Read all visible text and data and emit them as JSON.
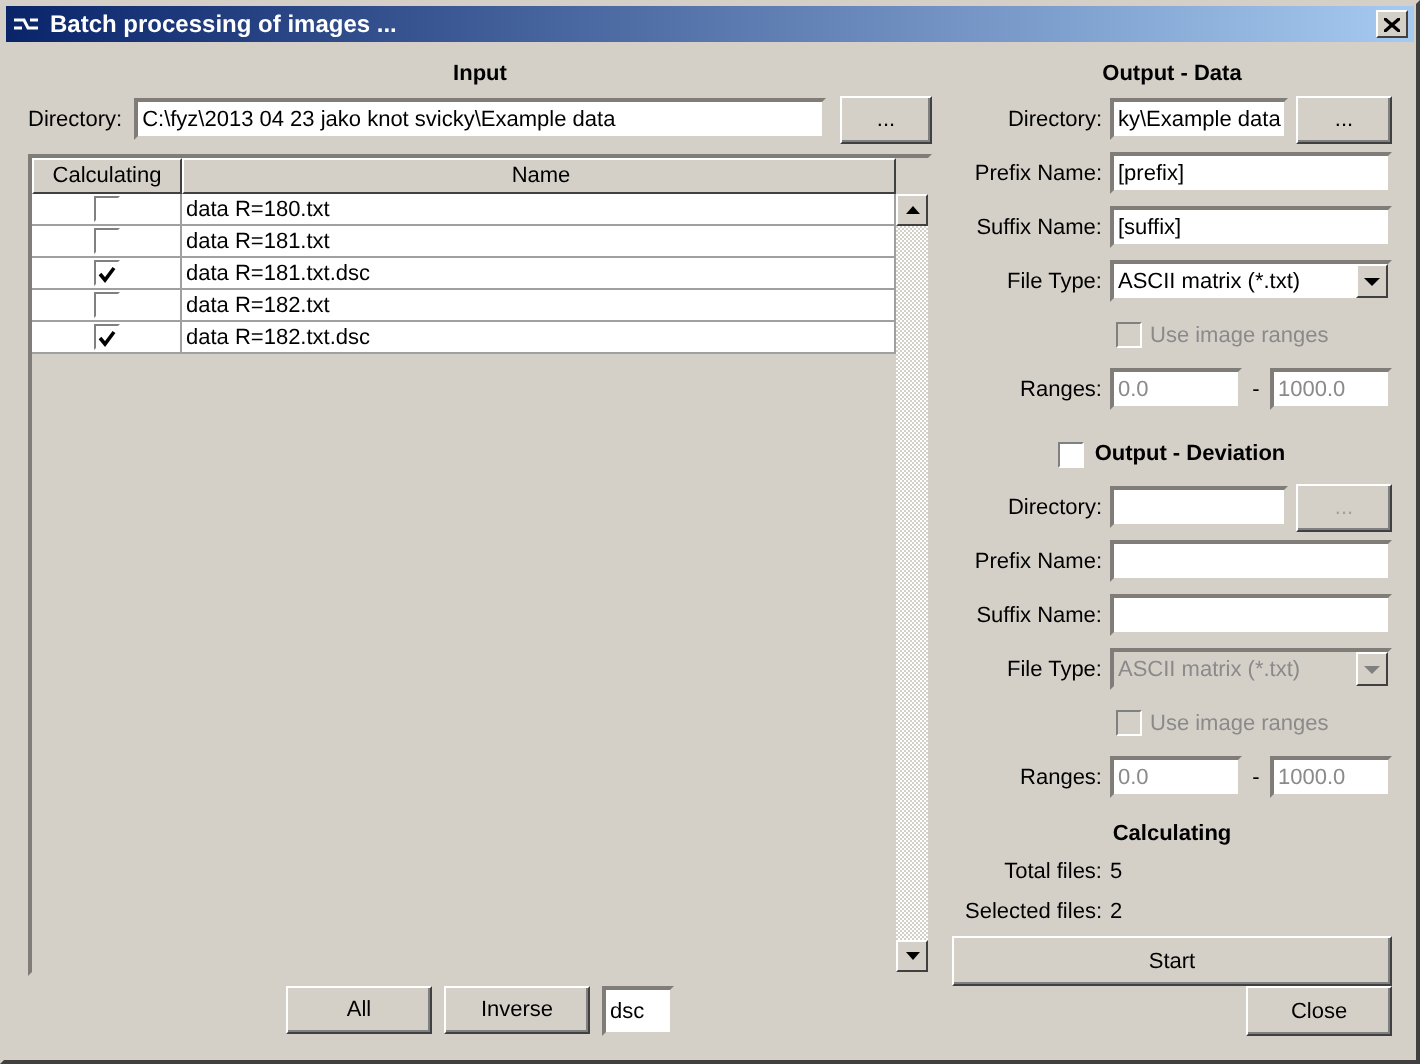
{
  "window": {
    "title": "Batch processing of images ..."
  },
  "input": {
    "heading": "Input",
    "directory_label": "Directory:",
    "directory": "C:\\fyz\\2013 04 23 jako knot svicky\\Example data",
    "browse_button": "...",
    "table": {
      "columns": [
        "Calculating",
        "Name"
      ],
      "rows": [
        {
          "checked": false,
          "name": "data R=180.txt"
        },
        {
          "checked": false,
          "name": "data R=181.txt"
        },
        {
          "checked": true,
          "name": "data R=181.txt.dsc"
        },
        {
          "checked": false,
          "name": "data R=182.txt"
        },
        {
          "checked": true,
          "name": "data R=182.txt.dsc"
        }
      ]
    },
    "buttons": [
      "All",
      "Inverse"
    ],
    "filter": "dsc"
  },
  "output_data": {
    "heading": "Output - Data",
    "directory_label": "Directory:",
    "directory": "ky\\Example data",
    "browse_button": "...",
    "browse_disabled": false,
    "prefix_label": "Prefix Name:",
    "prefix": "[prefix]",
    "suffix_label": "Suffix Name:",
    "suffix": "[suffix]",
    "file_type_label": "File Type:",
    "file_type": "ASCII matrix (*.txt)",
    "file_type_disabled": false,
    "use_ranges": {
      "label": "Use image ranges",
      "checked": false,
      "disabled": true
    },
    "ranges_label": "Ranges:",
    "range_from": "0.0",
    "range_separator": "-",
    "range_to": "1000.0",
    "ranges_disabled": true
  },
  "output_deviation": {
    "checked": false,
    "heading": "Output - Deviation",
    "directory_label": "Directory:",
    "browse_button": "...",
    "browse_disabled": true,
    "prefix_label": "Prefix Name:",
    "suffix_label": "Suffix Name:",
    "file_type_label": "File Type:",
    "file_type": "ASCII matrix (*.txt)",
    "file_type_disabled": true,
    "use_ranges": {
      "label": "Use image ranges",
      "checked": false,
      "disabled": true
    },
    "ranges_label": "Ranges:",
    "range_from": "0.0",
    "range_separator": "-",
    "range_to": "1000.0",
    "ranges_disabled": true
  },
  "calculating": {
    "heading": "Calculating",
    "total_label": "Total files:",
    "total": "5",
    "selected_label": "Selected files:",
    "selected": "2",
    "start_button": "Start"
  },
  "close_button": "Close"
}
